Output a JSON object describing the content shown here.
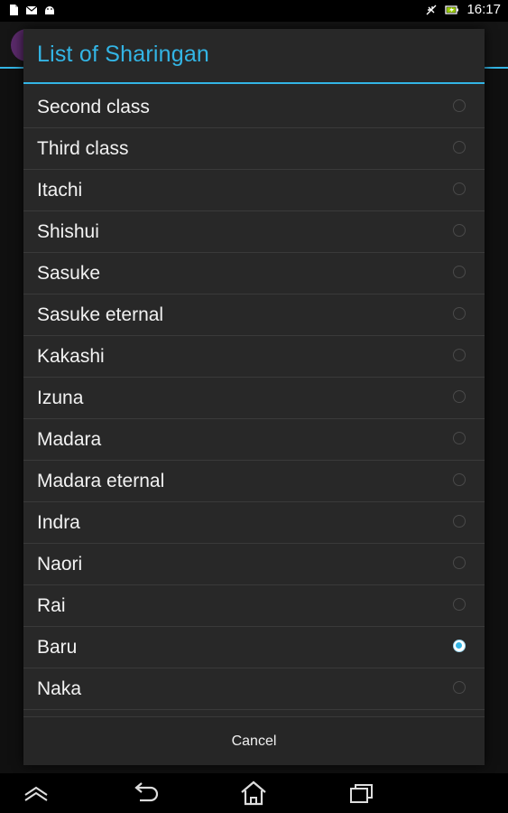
{
  "status_bar": {
    "time": "16:17",
    "left_icons": [
      "document-icon",
      "mail-icon",
      "android-icon"
    ],
    "right_icons": [
      "rotation-lock-icon",
      "battery-charging-icon"
    ]
  },
  "dialog": {
    "title": "List of Sharingan",
    "items": [
      {
        "label": "Second class",
        "selected": false
      },
      {
        "label": "Third class",
        "selected": false
      },
      {
        "label": "Itachi",
        "selected": false
      },
      {
        "label": "Shishui",
        "selected": false
      },
      {
        "label": "Sasuke",
        "selected": false
      },
      {
        "label": "Sasuke eternal",
        "selected": false
      },
      {
        "label": "Kakashi",
        "selected": false
      },
      {
        "label": "Izuna",
        "selected": false
      },
      {
        "label": "Madara",
        "selected": false
      },
      {
        "label": "Madara eternal",
        "selected": false
      },
      {
        "label": "Indra",
        "selected": false
      },
      {
        "label": "Naori",
        "selected": false
      },
      {
        "label": "Rai",
        "selected": false
      },
      {
        "label": "Baru",
        "selected": true
      },
      {
        "label": "Naka",
        "selected": false
      }
    ],
    "cancel_label": "Cancel"
  },
  "nav_bar": {
    "buttons": [
      "menu-up-icon",
      "back-icon",
      "home-icon",
      "recent-apps-icon"
    ]
  },
  "colors": {
    "accent": "#33b5e5",
    "dialog_bg": "#282828",
    "divider": "#3a3a3a",
    "text": "#f2f2f2"
  }
}
